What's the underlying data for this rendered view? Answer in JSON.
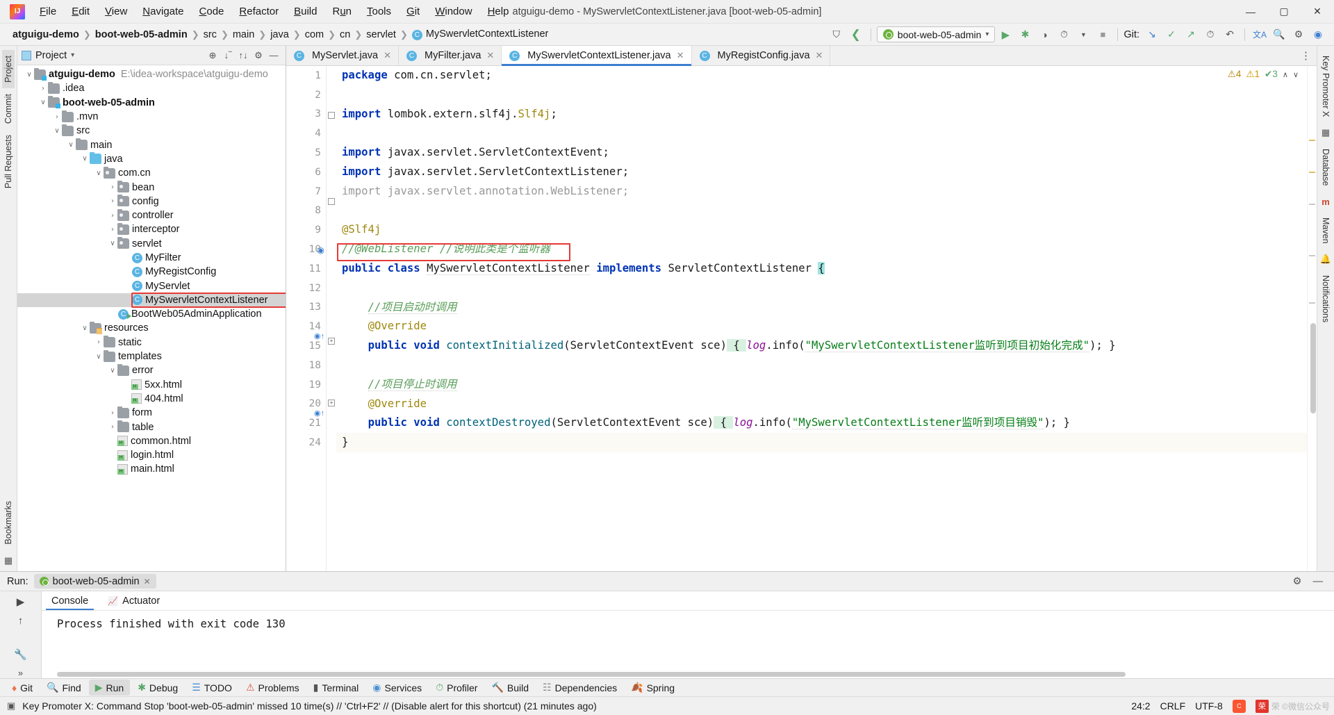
{
  "window": {
    "title": "atguigu-demo - MySwervletContextListener.java [boot-web-05-admin]",
    "minimize": "—",
    "maximize": "▢",
    "close": "✕"
  },
  "menubar": [
    {
      "label": "File",
      "mnemonic": "F"
    },
    {
      "label": "Edit",
      "mnemonic": "E"
    },
    {
      "label": "View",
      "mnemonic": "V"
    },
    {
      "label": "Navigate",
      "mnemonic": "N"
    },
    {
      "label": "Code",
      "mnemonic": "C"
    },
    {
      "label": "Refactor",
      "mnemonic": "R"
    },
    {
      "label": "Build",
      "mnemonic": "B"
    },
    {
      "label": "Run",
      "mnemonic": "u"
    },
    {
      "label": "Tools",
      "mnemonic": "T"
    },
    {
      "label": "Git",
      "mnemonic": "G"
    },
    {
      "label": "Window",
      "mnemonic": "W"
    },
    {
      "label": "Help",
      "mnemonic": "H"
    }
  ],
  "breadcrumbs": [
    {
      "label": "atguigu-demo",
      "bold": true
    },
    {
      "label": "boot-web-05-admin",
      "bold": true
    },
    {
      "label": "src",
      "bold": false
    },
    {
      "label": "main",
      "bold": false
    },
    {
      "label": "java",
      "bold": false
    },
    {
      "label": "com",
      "bold": false
    },
    {
      "label": "cn",
      "bold": false
    },
    {
      "label": "servlet",
      "bold": false
    },
    {
      "label": "MySwervletContextListener",
      "bold": false,
      "class_icon": "C"
    }
  ],
  "toolbar": {
    "run_config": "boot-web-05-admin",
    "run_config_caret": "▾",
    "icons": [
      {
        "name": "user-icon",
        "glyph": "⛉"
      },
      {
        "name": "back-arrow-icon",
        "glyph": "‹"
      },
      {
        "name": "run-icon",
        "glyph": "▶"
      },
      {
        "name": "debug-icon",
        "glyph": "✱"
      },
      {
        "name": "run-coverage-icon",
        "glyph": "◑"
      },
      {
        "name": "profile-icon",
        "glyph": "◴"
      },
      {
        "name": "profile-dropdown-icon",
        "glyph": "▾"
      },
      {
        "name": "stop-icon",
        "glyph": "■"
      }
    ],
    "git_label": "Git:",
    "git_icons": [
      {
        "name": "git-update-icon",
        "glyph": "↙"
      },
      {
        "name": "git-commit-icon",
        "glyph": "✓"
      },
      {
        "name": "git-push-icon",
        "glyph": "↗"
      },
      {
        "name": "git-history-icon",
        "glyph": "◴"
      },
      {
        "name": "git-rollback-icon",
        "glyph": "↶"
      }
    ],
    "right_icons": [
      {
        "name": "translate-icon",
        "glyph": "文"
      },
      {
        "name": "search-everywhere-icon",
        "glyph": "⚲"
      },
      {
        "name": "settings-icon",
        "glyph": "⚙"
      },
      {
        "name": "account-icon",
        "glyph": "◕"
      }
    ]
  },
  "left_strip": [
    {
      "label": "Project",
      "active": true
    },
    {
      "label": "Commit",
      "active": false
    },
    {
      "label": "Pull Requests",
      "active": false
    }
  ],
  "left_strip_bottom": [
    {
      "label": "Bookmarks",
      "active": false
    }
  ],
  "left_strip_icons": [
    {
      "name": "structure-icon",
      "glyph": "⊞"
    }
  ],
  "right_strip": [
    {
      "label": "Key Promoter X",
      "active": false
    },
    {
      "label": "Database",
      "active": false
    },
    {
      "label": "Maven",
      "active": false
    },
    {
      "label": "Notifications",
      "active": false
    }
  ],
  "project_panel": {
    "title": "Project",
    "caret": "▾",
    "header_icons": [
      {
        "name": "locate-icon",
        "glyph": "⊕"
      },
      {
        "name": "collapse-all-icon",
        "glyph": "⤓"
      },
      {
        "name": "expand-all-icon",
        "glyph": "⤒"
      },
      {
        "name": "settings-icon",
        "glyph": "⚙"
      },
      {
        "name": "hide-icon",
        "glyph": "—"
      }
    ],
    "tree": [
      {
        "indent": 0,
        "arrow": "∨",
        "icon": "module-folder",
        "label": "atguigu-demo",
        "bold": true,
        "path": "E:\\idea-workspace\\atguigu-demo"
      },
      {
        "indent": 1,
        "arrow": "›",
        "icon": "folder",
        "label": ".idea",
        "bold": false,
        "path": ""
      },
      {
        "indent": 1,
        "arrow": "∨",
        "icon": "module-folder",
        "label": "boot-web-05-admin",
        "bold": true,
        "path": ""
      },
      {
        "indent": 2,
        "arrow": "›",
        "icon": "folder",
        "label": ".mvn",
        "bold": false,
        "path": ""
      },
      {
        "indent": 2,
        "arrow": "∨",
        "icon": "folder",
        "label": "src",
        "bold": false,
        "path": ""
      },
      {
        "indent": 3,
        "arrow": "∨",
        "icon": "folder",
        "label": "main",
        "bold": false,
        "path": ""
      },
      {
        "indent": 4,
        "arrow": "∨",
        "icon": "source-folder",
        "label": "java",
        "bold": false,
        "path": ""
      },
      {
        "indent": 5,
        "arrow": "∨",
        "icon": "package-folder",
        "label": "com.cn",
        "bold": false,
        "path": ""
      },
      {
        "indent": 6,
        "arrow": "›",
        "icon": "package-folder",
        "label": "bean",
        "bold": false,
        "path": ""
      },
      {
        "indent": 6,
        "arrow": "›",
        "icon": "package-folder",
        "label": "config",
        "bold": false,
        "path": ""
      },
      {
        "indent": 6,
        "arrow": "›",
        "icon": "package-folder",
        "label": "controller",
        "bold": false,
        "path": ""
      },
      {
        "indent": 6,
        "arrow": "›",
        "icon": "package-folder",
        "label": "interceptor",
        "bold": false,
        "path": ""
      },
      {
        "indent": 6,
        "arrow": "∨",
        "icon": "package-folder",
        "label": "servlet",
        "bold": false,
        "path": ""
      },
      {
        "indent": 7,
        "arrow": "",
        "icon": "java-class",
        "label": "MyFilter",
        "bold": false,
        "path": ""
      },
      {
        "indent": 7,
        "arrow": "",
        "icon": "java-class",
        "label": "MyRegistConfig",
        "bold": false,
        "path": ""
      },
      {
        "indent": 7,
        "arrow": "",
        "icon": "java-class",
        "label": "MyServlet",
        "bold": false,
        "path": ""
      },
      {
        "indent": 7,
        "arrow": "",
        "icon": "java-class",
        "label": "MySwervletContextListener",
        "bold": false,
        "path": "",
        "selected": true,
        "highlighted": true
      },
      {
        "indent": 6,
        "arrow": "",
        "icon": "java-main-class",
        "label": "BootWeb05AdminApplication",
        "bold": false,
        "path": ""
      },
      {
        "indent": 4,
        "arrow": "∨",
        "icon": "resources-folder",
        "label": "resources",
        "bold": false,
        "path": ""
      },
      {
        "indent": 5,
        "arrow": "›",
        "icon": "folder",
        "label": "static",
        "bold": false,
        "path": ""
      },
      {
        "indent": 5,
        "arrow": "∨",
        "icon": "folder",
        "label": "templates",
        "bold": false,
        "path": ""
      },
      {
        "indent": 6,
        "arrow": "∨",
        "icon": "folder",
        "label": "error",
        "bold": false,
        "path": ""
      },
      {
        "indent": 7,
        "arrow": "",
        "icon": "html-file",
        "label": "5xx.html",
        "bold": false,
        "path": ""
      },
      {
        "indent": 7,
        "arrow": "",
        "icon": "html-file",
        "label": "404.html",
        "bold": false,
        "path": ""
      },
      {
        "indent": 6,
        "arrow": "›",
        "icon": "folder",
        "label": "form",
        "bold": false,
        "path": ""
      },
      {
        "indent": 6,
        "arrow": "›",
        "icon": "folder",
        "label": "table",
        "bold": false,
        "path": ""
      },
      {
        "indent": 6,
        "arrow": "",
        "icon": "html-file",
        "label": "common.html",
        "bold": false,
        "path": ""
      },
      {
        "indent": 6,
        "arrow": "",
        "icon": "html-file",
        "label": "login.html",
        "bold": false,
        "path": ""
      },
      {
        "indent": 6,
        "arrow": "",
        "icon": "html-file",
        "label": "main.html",
        "bold": false,
        "path": ""
      }
    ]
  },
  "editor": {
    "tabs": [
      {
        "label": "MyServlet.java",
        "active": false,
        "close": "✕"
      },
      {
        "label": "MyFilter.java",
        "active": false,
        "close": "✕"
      },
      {
        "label": "MySwervletContextListener.java",
        "active": true,
        "close": "✕"
      },
      {
        "label": "MyRegistConfig.java",
        "active": false,
        "close": "✕"
      }
    ],
    "tabs_overflow_icon": "⋮",
    "inspections": {
      "warnings_grey": "4",
      "warnings_yellow": "1",
      "typos_green": "3",
      "collapse": "∧",
      "expand": "∨"
    },
    "line_numbers": [
      "1",
      "2",
      "3",
      "4",
      "5",
      "6",
      "7",
      "8",
      "9",
      "10",
      "11",
      "12",
      "13",
      "14",
      "15",
      "18",
      "19",
      "20",
      "21",
      "24"
    ],
    "lines": [
      {
        "n": "1",
        "text": "package com.cn.servlet;"
      },
      {
        "n": "2",
        "text": ""
      },
      {
        "n": "3",
        "text": "import lombok.extern.slf4j.Slf4j;"
      },
      {
        "n": "4",
        "text": ""
      },
      {
        "n": "5",
        "text": "import javax.servlet.ServletContextEvent;"
      },
      {
        "n": "6",
        "text": "import javax.servlet.ServletContextListener;"
      },
      {
        "n": "7",
        "text": "import javax.servlet.annotation.WebListener;"
      },
      {
        "n": "8",
        "text": ""
      },
      {
        "n": "9",
        "text": "@Slf4j"
      },
      {
        "n": "10",
        "text": "//@WebListener //说明此类是个监听器"
      },
      {
        "n": "11",
        "text": "public class MySwervletContextListener implements ServletContextListener {"
      },
      {
        "n": "12",
        "text": ""
      },
      {
        "n": "13",
        "text": "    //项目启动时调用"
      },
      {
        "n": "14",
        "text": "    @Override"
      },
      {
        "n": "15",
        "text": "    public void contextInitialized(ServletContextEvent sce) { log.info(\"MySwervletContextListener监听到项目初始化完成\"); }"
      },
      {
        "n": "18",
        "text": ""
      },
      {
        "n": "19",
        "text": "    //项目停止时调用"
      },
      {
        "n": "20",
        "text": "    @Override"
      },
      {
        "n": "21",
        "text": "    public void contextDestroyed(ServletContextEvent sce) { log.info(\"MySwervletContextListener监听到项目销毁\"); }"
      },
      {
        "n": "24",
        "text": "}"
      }
    ],
    "code_tokens": {
      "line1_kw": "package",
      "line1_rest": " com.cn.servlet;",
      "line3_kw": "import",
      "line3_pkg": " lombok.extern.slf4j.",
      "line3_cls": "Slf4j",
      "line3_end": ";",
      "line5_kw": "import",
      "line5_rest": " javax.servlet.ServletContextEvent;",
      "line6_kw": "import",
      "line6_rest": " javax.servlet.ServletContextListener;",
      "line7_all": "import javax.servlet.annotation.WebListener;",
      "line9_ann": "@Slf4j",
      "line10_cmt": "//@WebListener ",
      "line10_cmt2": "//说明此类是个监听器",
      "line11_kw1": "public",
      "line11_kw2": "class",
      "line11_name": "MySwervletContextListener",
      "line11_kw3": "implements",
      "line11_iface": "ServletContextListener",
      "line11_brace": "{",
      "line13_cmt": "//项目启动时调用",
      "line14_ann": "@Override",
      "line15_kw1": "public",
      "line15_kw2": "void",
      "line15_mth": "contextInitialized",
      "line15_params": "(ServletContextEvent sce)",
      "line15_brace_open": " { ",
      "line15_log": "log",
      "line15_info": ".info(",
      "line15_str": "\"MySwervletContextListener监听到项目初始化完成\"",
      "line15_end": "); }",
      "line19_cmt": "//项目停止时调用",
      "line20_ann": "@Override",
      "line21_kw1": "public",
      "line21_kw2": "void",
      "line21_mth": "contextDestroyed",
      "line21_params": "(ServletContextEvent sce)",
      "line21_brace_open": " { ",
      "line21_log": "log",
      "line21_info": ".info(",
      "line21_str": "\"MySwervletContextListener监听到项目销毁\"",
      "line21_end": "); }",
      "line24_brace": "}"
    }
  },
  "run_panel": {
    "label": "Run:",
    "config_name": "boot-web-05-admin",
    "close": "✕",
    "settings_icon": "⚙",
    "hide_icon": "—",
    "left_icons": [
      {
        "name": "rerun-icon",
        "glyph": "▶"
      },
      {
        "name": "scroll-up-icon",
        "glyph": "↑"
      },
      {
        "name": "wrench-icon",
        "glyph": "⚒"
      },
      {
        "name": "expand-icon",
        "glyph": "»"
      }
    ],
    "tabs": [
      {
        "label": "Console",
        "active": true,
        "icon": ""
      },
      {
        "label": "Actuator",
        "active": false,
        "icon": "actuator-icon"
      }
    ],
    "console_output": "Process finished with exit code 130"
  },
  "bottom_tabs": [
    {
      "label": "Git",
      "icon": "git-icon",
      "active": false
    },
    {
      "label": "Find",
      "icon": "find-icon",
      "active": false
    },
    {
      "label": "Run",
      "icon": "run-icon",
      "active": true
    },
    {
      "label": "Debug",
      "icon": "debug-icon",
      "active": false
    },
    {
      "label": "TODO",
      "icon": "todo-icon",
      "active": false
    },
    {
      "label": "Problems",
      "icon": "problems-icon",
      "active": false
    },
    {
      "label": "Terminal",
      "icon": "terminal-icon",
      "active": false
    },
    {
      "label": "Services",
      "icon": "services-icon",
      "active": false
    },
    {
      "label": "Profiler",
      "icon": "profiler-icon",
      "active": false
    },
    {
      "label": "Build",
      "icon": "build-icon",
      "active": false
    },
    {
      "label": "Dependencies",
      "icon": "dependencies-icon",
      "active": false
    },
    {
      "label": "Spring",
      "icon": "spring-icon",
      "active": false
    }
  ],
  "statusbar": {
    "message": "Key Promoter X: Command Stop 'boot-web-05-admin' missed 10 time(s) // 'Ctrl+F2' // (Disable alert for this shortcut) (21 minutes ago)",
    "caret_position": "24:2",
    "line_separator": "CRLF",
    "encoding": "UTF-8",
    "watermark_text": "荣 ©微信公众号",
    "watermark_badge": "荣",
    "csdn_badge": "C"
  },
  "colors": {
    "accent_blue": "#3c7fd0",
    "keyword_blue": "#0033b3",
    "string_green": "#067d17",
    "comment_green": "#5a9e5a",
    "annotation_gold": "#9e880d",
    "field_purple": "#871094",
    "highlight_red": "#e53935",
    "spring_green": "#6db33f"
  }
}
